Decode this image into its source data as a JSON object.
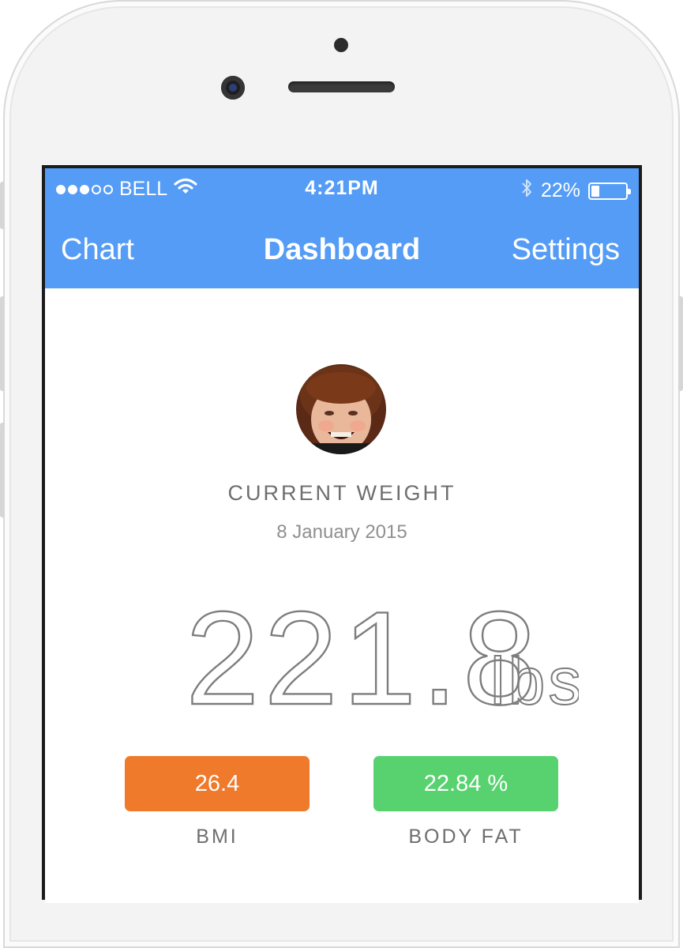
{
  "status_bar": {
    "carrier": "BELL",
    "time": "4:21PM",
    "battery_percent": "22%",
    "signal_bars_filled": 3,
    "signal_bars_total": 5,
    "battery_level": 0.22
  },
  "nav": {
    "left": "Chart",
    "title": "Dashboard",
    "right": "Settings"
  },
  "profile": {
    "weight_label": "CURRENT WEIGHT",
    "date": "8 January 2015",
    "weight_value": "221.8",
    "weight_unit": "lbs"
  },
  "metrics": {
    "bmi_value": "26.4",
    "bmi_label": "BMI",
    "bodyfat_value": "22.84 %",
    "bodyfat_label": "BODY FAT"
  },
  "colors": {
    "navbar": "#549cf5",
    "bmi": "#f07a2b",
    "bodyfat": "#57d26f"
  }
}
